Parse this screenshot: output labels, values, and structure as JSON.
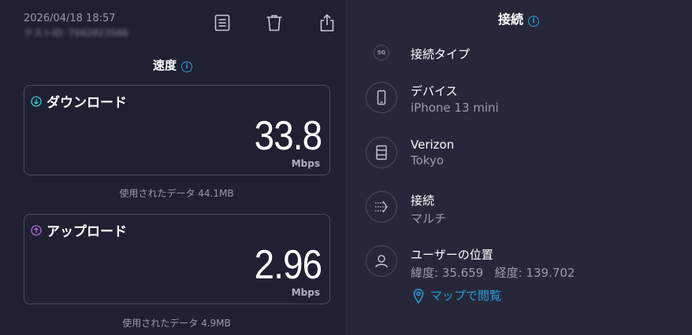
{
  "header": {
    "timestamp": "2026/04/18 18:57",
    "test_id": "テストID: 7042823566"
  },
  "toolbar": {
    "icons": [
      "results-list-icon",
      "trash-icon",
      "share-icon"
    ]
  },
  "speed": {
    "title": "速度",
    "download": {
      "label": "ダウンロード",
      "value": "33.8",
      "unit": "Mbps",
      "data_used": "使用されたデータ 44.1MB"
    },
    "upload": {
      "label": "アップロード",
      "value": "2.96",
      "unit": "Mbps",
      "data_used": "使用されたデータ 4.9MB"
    }
  },
  "connection": {
    "title": "接続",
    "type_label": "接続タイプ",
    "type_badge": "5G",
    "device": {
      "title": "デバイス",
      "value": "iPhone 13 mini"
    },
    "provider": {
      "title": "Verizon",
      "value": "Tokyo"
    },
    "connections": {
      "title": "接続",
      "value": "マルチ"
    },
    "location": {
      "title": "ユーザーの位置",
      "value": "緯度: 35.659   経度: 139.702",
      "map_link": "マップで閲覧"
    }
  },
  "colors": {
    "background": "#1f2032",
    "panel": "#262839",
    "accent": "#2d9cdb",
    "download_accent": "#39c6d6",
    "upload_accent": "#b36bd9"
  }
}
